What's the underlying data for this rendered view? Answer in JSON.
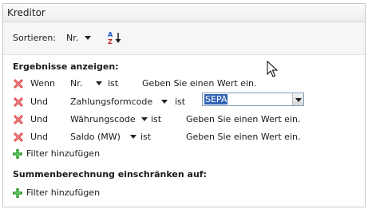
{
  "window": {
    "title": "Kreditor"
  },
  "sort": {
    "label": "Sortieren:",
    "field": "Nr.",
    "icon": "sort-az-icon"
  },
  "results": {
    "heading": "Ergebnisse anzeigen:",
    "filters": [
      {
        "conj": "Wenn",
        "field": "Nr.",
        "op": "ist",
        "value": "Geben Sie einen Wert ein."
      },
      {
        "conj": "Und",
        "field": "Zahlungsformcode",
        "op": "ist",
        "value": "SEPA"
      },
      {
        "conj": "Und",
        "field": "Währungscode",
        "op": "ist",
        "value": "Geben Sie einen Wert ein."
      },
      {
        "conj": "Und",
        "field": "Saldo (MW)",
        "op": "ist",
        "value": "Geben Sie einen Wert ein."
      }
    ],
    "add_filter": "Filter hinzufügen"
  },
  "totals": {
    "heading": "Summenberechnung einschränken auf:",
    "add_filter": "Filter hinzufügen"
  },
  "colors": {
    "delete": "#d63a3a",
    "add": "#2e9a2e",
    "selection": "#3264b4"
  }
}
